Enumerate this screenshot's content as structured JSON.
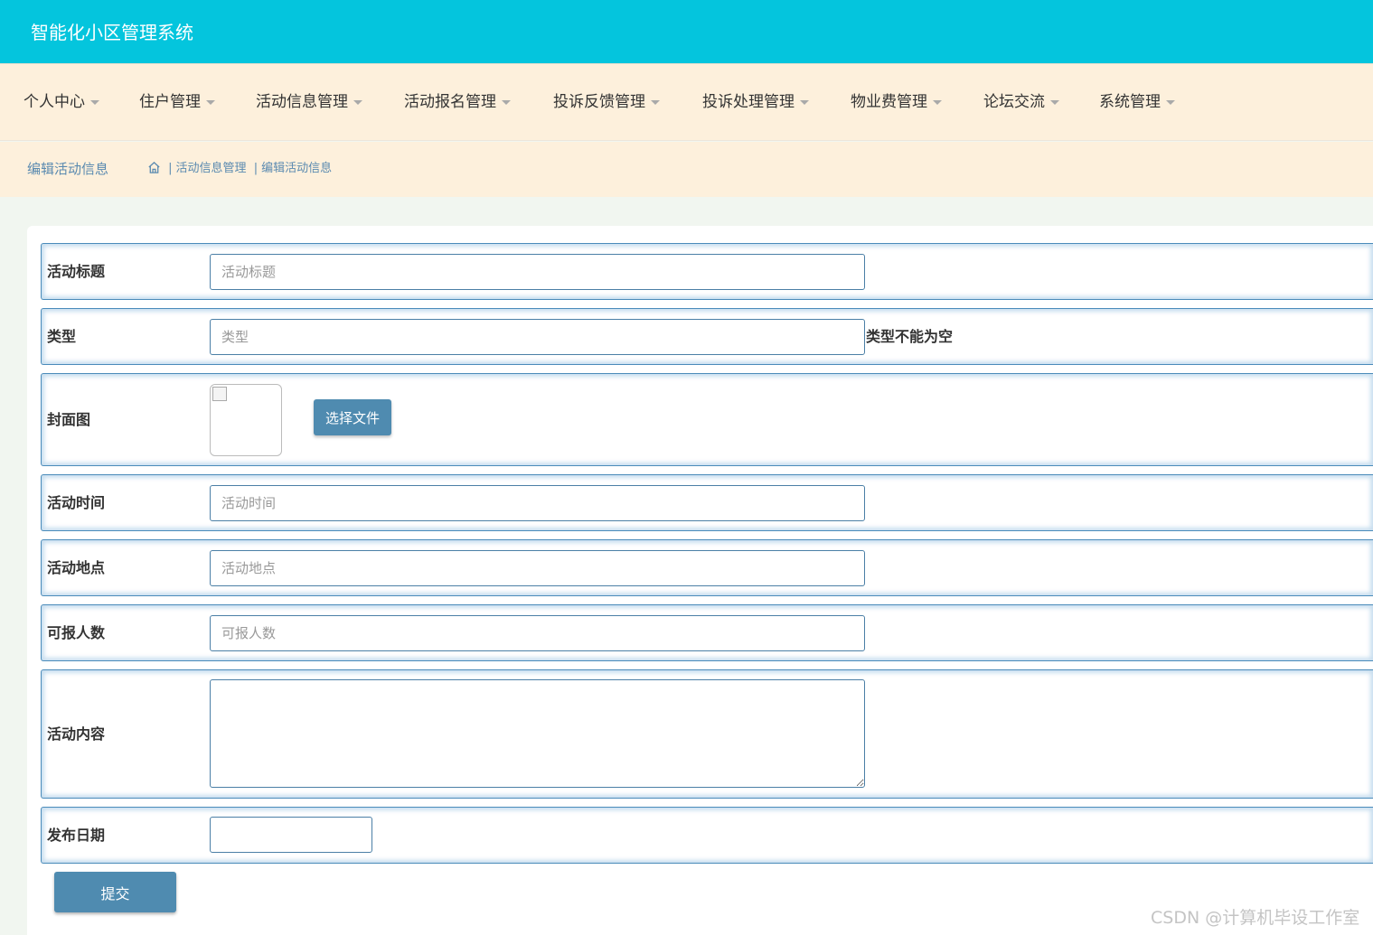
{
  "app": {
    "title": "智能化小区管理系统"
  },
  "nav": {
    "items": [
      {
        "label": "个人中心"
      },
      {
        "label": "住户管理"
      },
      {
        "label": "活动信息管理"
      },
      {
        "label": "活动报名管理"
      },
      {
        "label": "投诉反馈管理"
      },
      {
        "label": "投诉处理管理"
      },
      {
        "label": "物业费管理"
      },
      {
        "label": "论坛交流"
      },
      {
        "label": "系统管理"
      }
    ]
  },
  "breadcrumb": {
    "page_title": "编辑活动信息",
    "separator": "|",
    "path": [
      "活动信息管理",
      "编辑活动信息"
    ]
  },
  "form": {
    "title": {
      "label": "活动标题",
      "placeholder": "活动标题",
      "value": ""
    },
    "type": {
      "label": "类型",
      "placeholder": "类型",
      "value": "",
      "error": "类型不能为空"
    },
    "cover": {
      "label": "封面图",
      "button": "选择文件"
    },
    "time": {
      "label": "活动时间",
      "placeholder": "活动时间",
      "value": ""
    },
    "location": {
      "label": "活动地点",
      "placeholder": "活动地点",
      "value": ""
    },
    "capacity": {
      "label": "可报人数",
      "placeholder": "可报人数",
      "value": ""
    },
    "content": {
      "label": "活动内容",
      "value": ""
    },
    "publish_date": {
      "label": "发布日期",
      "value": ""
    },
    "submit": "提交"
  },
  "watermark": "CSDN @计算机毕设工作室",
  "colors": {
    "header": "#04c5dd",
    "nav_bg": "#fdf0dc",
    "accent": "#4f8bb0",
    "border": "#4a8bba"
  }
}
